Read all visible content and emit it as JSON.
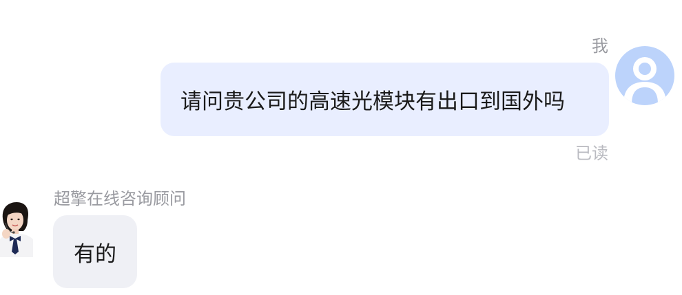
{
  "conversation": {
    "outgoing": {
      "sender_name": "我",
      "text": "请问贵公司的高速光模块有出口到国外吗",
      "status": "已读",
      "avatar_icon": "default-user-avatar-icon",
      "bubble_color": "#e9eeff",
      "avatar_color": "#bcd3fb"
    },
    "incoming": {
      "sender_name": "超擎在线咨询顾问",
      "text": "有的",
      "avatar_icon": "agent-headset-avatar-icon",
      "bubble_color": "#eff0f5"
    }
  }
}
